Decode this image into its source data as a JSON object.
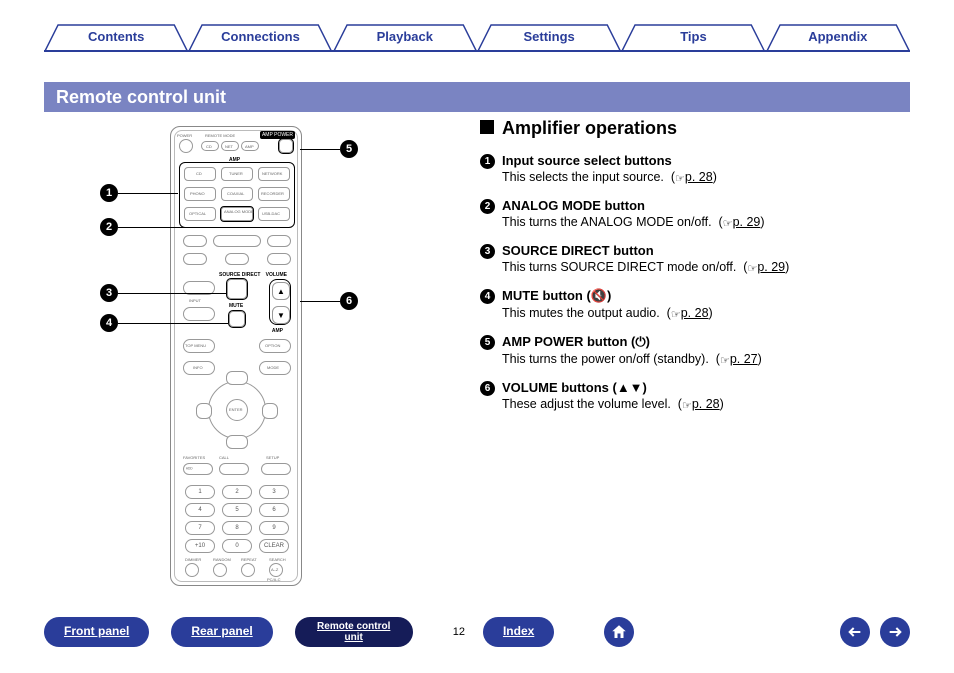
{
  "tabs": [
    {
      "label": "Contents"
    },
    {
      "label": "Connections"
    },
    {
      "label": "Playback"
    },
    {
      "label": "Settings"
    },
    {
      "label": "Tips"
    },
    {
      "label": "Appendix"
    }
  ],
  "section_title": "Remote control unit",
  "subsection_title": "Amplifier operations",
  "items": [
    {
      "num": "1",
      "title": "Input source select buttons",
      "body": "This selects the input source.",
      "page": "p. 28"
    },
    {
      "num": "2",
      "title": "ANALOG MODE button",
      "body": "This turns the ANALOG MODE on/off.",
      "page": "p. 29"
    },
    {
      "num": "3",
      "title": "SOURCE DIRECT button",
      "body": "This turns SOURCE DIRECT mode on/off.",
      "page": "p. 29"
    },
    {
      "num": "4",
      "title": "MUTE button (🔇)",
      "body": "This mutes the output audio.",
      "page": "p. 28"
    },
    {
      "num": "5",
      "title": "AMP POWER button (⏻)",
      "body": "This turns the power on/off (standby).",
      "page": "p. 27"
    },
    {
      "num": "6",
      "title": "VOLUME buttons (▲▼)",
      "body": "These adjust the volume level.",
      "page": "p. 28"
    }
  ],
  "footer": {
    "front": "Front panel",
    "rear": "Rear panel",
    "remote": "Remote control unit",
    "index": "Index",
    "page": "12"
  },
  "remote_labels": {
    "amp_power": "AMP POWER",
    "power": "POWER",
    "remote_mode": "REMOTE MODE",
    "cd": "CD",
    "net": "NET",
    "amp": "AMP",
    "amp_sec": "AMP",
    "source_cd": "CD",
    "source_tuner": "TUNER",
    "source_network": "NETWORK",
    "source_phono": "PHONO",
    "source_coaxial": "COAXIAL",
    "source_recorder": "RECORDER",
    "source_optical": "OPTICAL",
    "source_analog": "ANALOG MODE",
    "source_usbdac": "USB-DAC",
    "source_direct": "SOURCE DIRECT",
    "input": "INPUT",
    "mute": "MUTE",
    "volume": "VOLUME",
    "top_menu": "TOP MENU",
    "option": "OPTION",
    "enter": "ENTER",
    "favorites": "FAVORITES",
    "add": "ADD",
    "call": "CALL",
    "setup": "SETUP",
    "info": "INFO",
    "mode": "MODE",
    "clear": "CLEAR",
    "p10": "+10",
    "zero": "0",
    "dimmer": "DIMMER",
    "random": "RANDOM",
    "repeat": "REPEAT",
    "search": "SEARCH",
    "az": "A–Z",
    "pcac": "PC/A-C"
  }
}
